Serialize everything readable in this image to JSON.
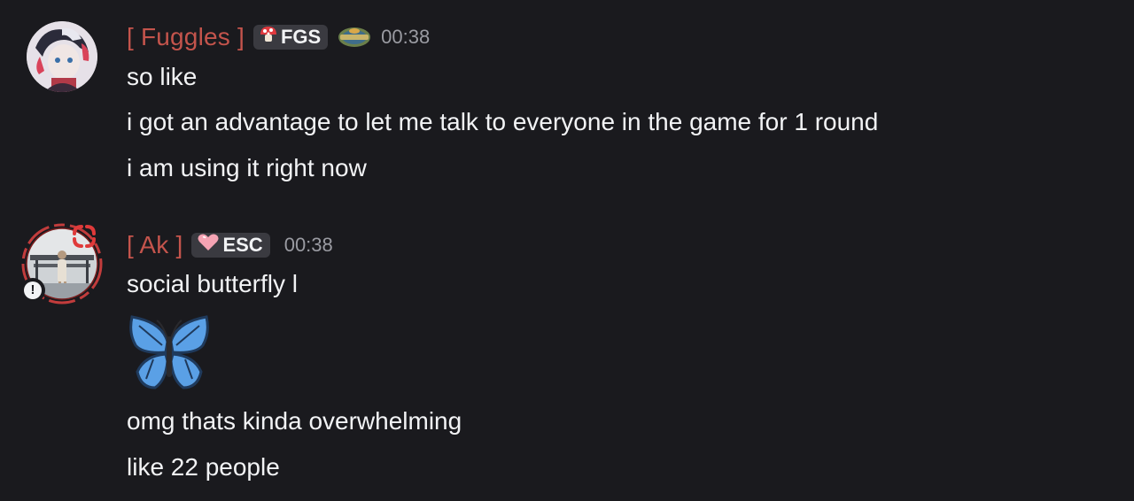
{
  "messages": [
    {
      "username": "[ Fuggles ]",
      "tag": "FGS",
      "tag_icon": "mushroom-icon",
      "role_icon": "survivor-logo-icon",
      "timestamp": "00:38",
      "lines": [
        "so like",
        "i got an advantage to let me talk to everyone in the game for 1 round",
        "i am using it right now"
      ]
    },
    {
      "username": "[ Ak ]",
      "tag": "ESC",
      "tag_icon": "pink-heart-icon",
      "timestamp": "00:38",
      "status_badge": "!",
      "lines_before_emoji": [
        "social butterfly l"
      ],
      "emoji": "butterfly-emoji",
      "lines_after_emoji": [
        "omg thats kinda overwhelming",
        "like 22 people"
      ]
    }
  ],
  "colors": {
    "background": "#1a1a1e",
    "username": "#c4544c",
    "text": "#f2f3f5",
    "timestamp": "#9a9ba2",
    "tag_bg": "#3a3a40"
  }
}
